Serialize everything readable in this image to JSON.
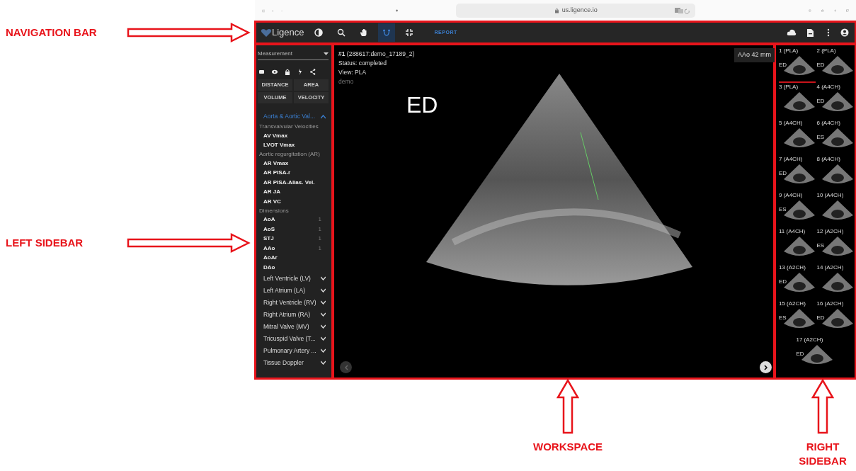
{
  "left_callouts": [
    {
      "label": "NAVIGATION BAR"
    },
    {
      "label": "LEFT SIDEBAR"
    }
  ],
  "bottom_callouts": [
    {
      "label": "WORKSPACE"
    },
    {
      "label": "RIGHT SIDEBAR"
    }
  ],
  "browser": {
    "address": "us.ligence.io"
  },
  "navbar": {
    "logo": "Ligence",
    "tools": [
      {
        "kind": "contrast",
        "selected": false
      },
      {
        "kind": "zoom",
        "selected": false
      },
      {
        "kind": "pan",
        "selected": false
      },
      {
        "kind": "measure",
        "selected": true
      },
      {
        "kind": "fit",
        "selected": false
      }
    ],
    "report": "REPORT",
    "actions": [
      {
        "kind": "cloud"
      },
      {
        "kind": "file"
      },
      {
        "kind": "more"
      },
      {
        "kind": "user"
      }
    ]
  },
  "sidebar": {
    "mode_select": "Measurement",
    "view_toggles": [
      {
        "kind": "label"
      },
      {
        "kind": "eye"
      },
      {
        "kind": "lock"
      },
      {
        "kind": "bolt"
      },
      {
        "kind": "share"
      }
    ],
    "tools": [
      "DISTANCE",
      "AREA",
      "VOLUME",
      "VELOCITY"
    ],
    "sections": [
      {
        "title": "Aorta & Aortic Val...",
        "expanded": true,
        "groups": [
          {
            "heading": "Transvalvular Velocities",
            "items": [
              {
                "label": "AV Vmax"
              },
              {
                "label": "LVOT Vmax"
              }
            ]
          },
          {
            "heading": "Aortic regurgitation (AR)",
            "items": [
              {
                "label": "AR Vmax"
              },
              {
                "label": "AR PISA-r"
              },
              {
                "label": "AR PISA-Alias. Vel."
              },
              {
                "label": "AR JA"
              },
              {
                "label": "AR VC"
              }
            ]
          },
          {
            "heading": "Dimensions",
            "items": [
              {
                "label": "AoA",
                "count": "1"
              },
              {
                "label": "AoS",
                "count": "1"
              },
              {
                "label": "STJ",
                "count": "1"
              },
              {
                "label": "AAo",
                "count": "1"
              },
              {
                "label": "AoAr"
              },
              {
                "label": "DAo"
              }
            ]
          }
        ]
      },
      {
        "title": "Left Ventricle (LV)",
        "expanded": false
      },
      {
        "title": "Left Atrium (LA)",
        "expanded": false
      },
      {
        "title": "Right Ventricle (RV)",
        "expanded": false
      },
      {
        "title": "Right Atrium (RA)",
        "expanded": false
      },
      {
        "title": "Mitral Valve (MV)",
        "expanded": false
      },
      {
        "title": "Tricuspid Valve (T...",
        "expanded": false
      },
      {
        "title": "Pulmonary Artery ...",
        "expanded": false
      },
      {
        "title": "Tissue Doppler",
        "expanded": false
      }
    ]
  },
  "workspace": {
    "title": "**#1** (288617:demo_17189_2)",
    "status": "Status: completed",
    "view": "View: PLA",
    "tag": "demo",
    "phase": "ED",
    "measurement": "AAo 42 mm",
    "prev": {
      "disabled": true
    },
    "next": {
      "disabled": false
    }
  },
  "thumbnails": [
    {
      "label": "1 (PLA)",
      "phase": "ED",
      "selected": true
    },
    {
      "label": "2 (PLA)",
      "phase": "ED",
      "selected": false
    },
    {
      "label": "3 (PLA)",
      "selected": false
    },
    {
      "label": "4 (A4CH)",
      "phase": "ED",
      "selected": false
    },
    {
      "label": "5 (A4CH)",
      "selected": false
    },
    {
      "label": "6 (A4CH)",
      "phase": "ES",
      "selected": false
    },
    {
      "label": "7 (A4CH)",
      "phase": "ED",
      "selected": false
    },
    {
      "label": "8 (A4CH)",
      "selected": false
    },
    {
      "label": "9 (A4CH)",
      "phase": "ES",
      "selected": false
    },
    {
      "label": "10 (A4CH)",
      "selected": false
    },
    {
      "label": "11 (A4CH)",
      "selected": false
    },
    {
      "label": "12 (A2CH)",
      "phase": "ES",
      "selected": false
    },
    {
      "label": "13 (A2CH)",
      "phase": "ED",
      "selected": false
    },
    {
      "label": "14 (A2CH)",
      "selected": false
    },
    {
      "label": "15 (A2CH)",
      "phase": "ES",
      "selected": false
    },
    {
      "label": "16 (A2CH)",
      "phase": "ED",
      "selected": false
    },
    {
      "label": "17 (A2CH)",
      "phase": "ED",
      "selected": false
    }
  ]
}
